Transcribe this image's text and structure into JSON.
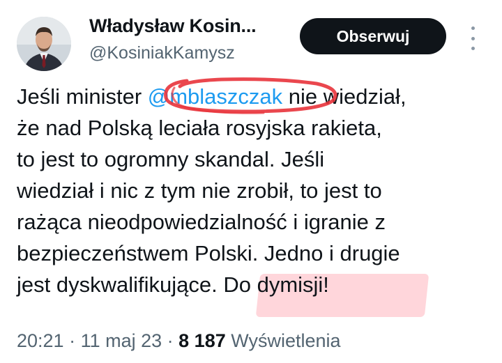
{
  "author": {
    "name": "Władysław Kosin...",
    "handle": "@KosiniakKamysz"
  },
  "follow_button": {
    "label": "Obserwuj"
  },
  "more_icon": "more-options-icon",
  "tweet": {
    "lines": [
      {
        "before": "Jeśli minister ",
        "mention": "@mblaszczak",
        "after": " nie wiedział,"
      },
      {
        "text": "że nad Polską leciała rosyjska rakieta,"
      },
      {
        "text": "to jest to ogromny skandal. Jeśli"
      },
      {
        "text": "wiedział i nic z tym nie zrobił, to jest to"
      },
      {
        "text": "rażąca nieodpowiedzialność i igranie z"
      },
      {
        "text": "bezpieczeństwem Polski. Jedno i drugie"
      },
      {
        "before": "jest dyskwalifikujące. ",
        "highlight": "Do dymisji!"
      }
    ]
  },
  "meta": {
    "time": "20:21",
    "sep1": " · ",
    "date": "11 maj 23",
    "sep2": " · ",
    "views_count": "8 187",
    "views_label": " Wyświetlenia"
  },
  "colors": {
    "mention": "#1d9bf0",
    "secondary_text": "#536471",
    "button_bg": "#0f1419",
    "annotation_circle": "#e8333b",
    "annotation_highlight": "#ffb4be"
  }
}
